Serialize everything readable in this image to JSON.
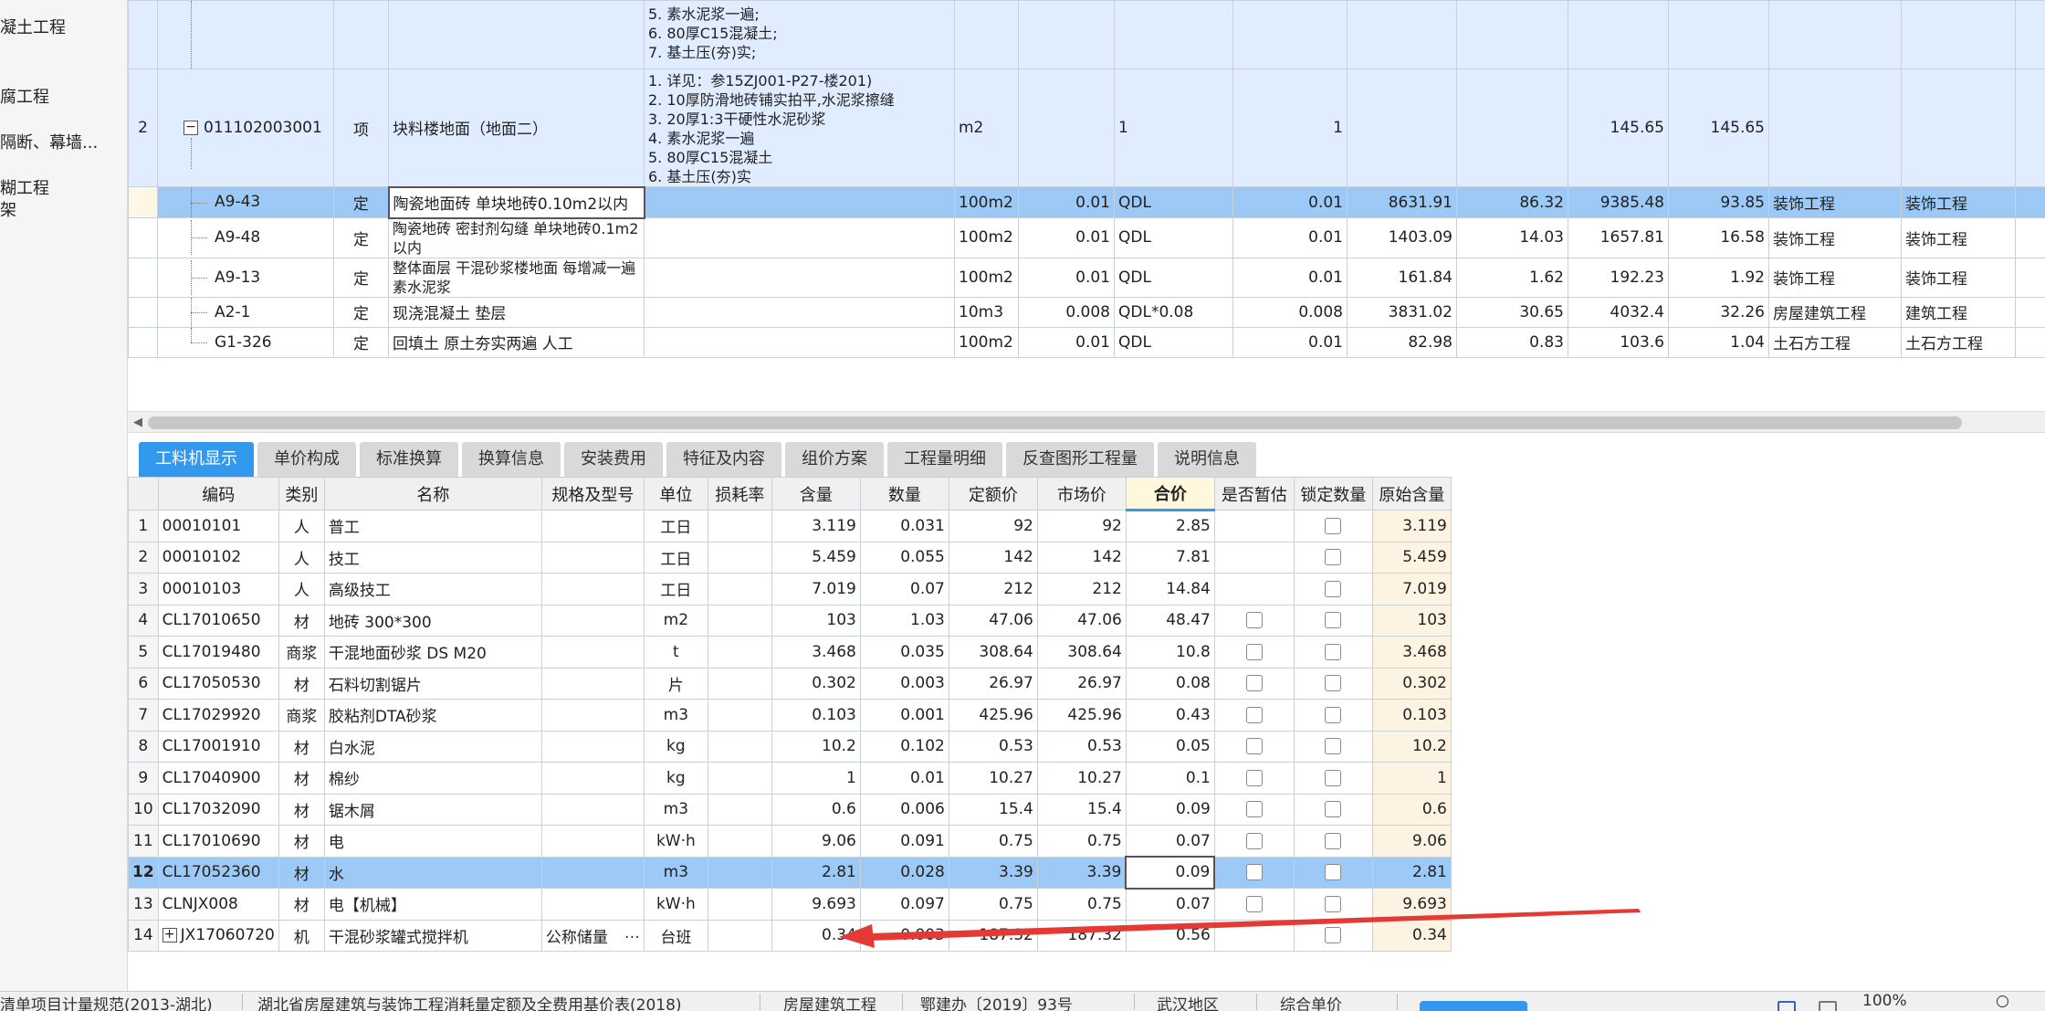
{
  "sidebar": {
    "items": [
      "凝土工程",
      "腐工程",
      "隔断、幕墙...",
      "糊工程",
      "架"
    ]
  },
  "upper_rows": [
    {
      "desc": [
        "5. 素水泥浆一遍;",
        "6. 80厚C15混凝土;",
        "7. 基土压(夯)实;"
      ]
    },
    {
      "num": "2",
      "code": "011102003001",
      "type": "项",
      "name": "块料楼地面（地面二）",
      "desc": [
        "1. 详见：参15ZJ001-P27-楼201)",
        "2. 10厚防滑地砖铺实拍平,水泥浆擦缝",
        "3. 20厚1:3干硬性水泥砂浆",
        "4. 素水泥浆一遍",
        "5. 80厚C15混凝土",
        "6. 基土压(夯)实"
      ],
      "unit": "m2",
      "qty_expr": "1",
      "qty": "1",
      "price_a": "",
      "price_b": "",
      "v1": "145.65",
      "v2": "145.65",
      "cat1": "",
      "cat2": ""
    },
    {
      "code": "A9-43",
      "type": "定",
      "name": "陶瓷地面砖 单块地砖0.10m2以内",
      "unit": "100m2",
      "ratio": "0.01",
      "qty_expr": "QDL",
      "qty": "0.01",
      "p1": "8631.91",
      "p2": "86.32",
      "p3": "9385.48",
      "p4": "93.85",
      "cat1": "装饰工程",
      "cat2": "装饰工程"
    },
    {
      "code": "A9-48",
      "type": "定",
      "name": "陶瓷地砖 密封剂勾缝 单块地砖0.1m2以内",
      "unit": "100m2",
      "ratio": "0.01",
      "qty_expr": "QDL",
      "qty": "0.01",
      "p1": "1403.09",
      "p2": "14.03",
      "p3": "1657.81",
      "p4": "16.58",
      "cat1": "装饰工程",
      "cat2": "装饰工程"
    },
    {
      "code": "A9-13",
      "type": "定",
      "name": "整体面层 干混砂浆楼地面 每增减一遍素水泥浆",
      "unit": "100m2",
      "ratio": "0.01",
      "qty_expr": "QDL",
      "qty": "0.01",
      "p1": "161.84",
      "p2": "1.62",
      "p3": "192.23",
      "p4": "1.92",
      "cat1": "装饰工程",
      "cat2": "装饰工程"
    },
    {
      "code": "A2-1",
      "type": "定",
      "name": "现浇混凝土 垫层",
      "unit": "10m3",
      "ratio": "0.008",
      "qty_expr": "QDL*0.08",
      "qty": "0.008",
      "p1": "3831.02",
      "p2": "30.65",
      "p3": "4032.4",
      "p4": "32.26",
      "cat1": "房屋建筑工程",
      "cat2": "建筑工程"
    },
    {
      "code": "G1-326",
      "type": "定",
      "name": "回填土 原土夯实两遍 人工",
      "unit": "100m2",
      "ratio": "0.01",
      "qty_expr": "QDL",
      "qty": "0.01",
      "p1": "82.98",
      "p2": "0.83",
      "p3": "103.6",
      "p4": "1.04",
      "cat1": "土石方工程",
      "cat2": "土石方工程"
    }
  ],
  "tabs": [
    "工料机显示",
    "单价构成",
    "标准换算",
    "换算信息",
    "安装费用",
    "特征及内容",
    "组价方案",
    "工程量明细",
    "反查图形工程量",
    "说明信息"
  ],
  "lower_headers": [
    "编码",
    "类别",
    "名称",
    "规格及型号",
    "单位",
    "损耗率",
    "含量",
    "数量",
    "定额价",
    "市场价",
    "合价",
    "是否暂估",
    "锁定数量",
    "原始含量"
  ],
  "lower_rows": [
    {
      "n": "1",
      "code": "00010101",
      "cat": "人",
      "name": "普工",
      "spec": "",
      "unit": "工日",
      "loss": "",
      "content": "3.119",
      "qty": "0.031",
      "quota": "92",
      "market": "92",
      "total": "2.85",
      "est": false,
      "orig": "3.119"
    },
    {
      "n": "2",
      "code": "00010102",
      "cat": "人",
      "name": "技工",
      "spec": "",
      "unit": "工日",
      "loss": "",
      "content": "5.459",
      "qty": "0.055",
      "quota": "142",
      "market": "142",
      "total": "7.81",
      "est": false,
      "orig": "5.459"
    },
    {
      "n": "3",
      "code": "00010103",
      "cat": "人",
      "name": "高级技工",
      "spec": "",
      "unit": "工日",
      "loss": "",
      "content": "7.019",
      "qty": "0.07",
      "quota": "212",
      "market": "212",
      "total": "14.84",
      "est": false,
      "orig": "7.019"
    },
    {
      "n": "4",
      "code": "CL17010650",
      "cat": "材",
      "name": "地砖 300*300",
      "spec": "",
      "unit": "m2",
      "loss": "",
      "content": "103",
      "qty": "1.03",
      "quota": "47.06",
      "market": "47.06",
      "total": "48.47",
      "est": true,
      "orig": "103"
    },
    {
      "n": "5",
      "code": "CL17019480",
      "cat": "商浆",
      "name": "干混地面砂浆 DS M20",
      "spec": "",
      "unit": "t",
      "loss": "",
      "content": "3.468",
      "qty": "0.035",
      "quota": "308.64",
      "market": "308.64",
      "total": "10.8",
      "est": true,
      "orig": "3.468"
    },
    {
      "n": "6",
      "code": "CL17050530",
      "cat": "材",
      "name": "石料切割锯片",
      "spec": "",
      "unit": "片",
      "loss": "",
      "content": "0.302",
      "qty": "0.003",
      "quota": "26.97",
      "market": "26.97",
      "total": "0.08",
      "est": true,
      "orig": "0.302"
    },
    {
      "n": "7",
      "code": "CL17029920",
      "cat": "商浆",
      "name": "胶粘剂DTA砂浆",
      "spec": "",
      "unit": "m3",
      "loss": "",
      "content": "0.103",
      "qty": "0.001",
      "quota": "425.96",
      "market": "425.96",
      "total": "0.43",
      "est": true,
      "orig": "0.103"
    },
    {
      "n": "8",
      "code": "CL17001910",
      "cat": "材",
      "name": "白水泥",
      "spec": "",
      "unit": "kg",
      "loss": "",
      "content": "10.2",
      "qty": "0.102",
      "quota": "0.53",
      "market": "0.53",
      "total": "0.05",
      "est": true,
      "orig": "10.2"
    },
    {
      "n": "9",
      "code": "CL17040900",
      "cat": "材",
      "name": "棉纱",
      "spec": "",
      "unit": "kg",
      "loss": "",
      "content": "1",
      "qty": "0.01",
      "quota": "10.27",
      "market": "10.27",
      "total": "0.1",
      "est": true,
      "orig": "1"
    },
    {
      "n": "10",
      "code": "CL17032090",
      "cat": "材",
      "name": "锯木屑",
      "spec": "",
      "unit": "m3",
      "loss": "",
      "content": "0.6",
      "qty": "0.006",
      "quota": "15.4",
      "market": "15.4",
      "total": "0.09",
      "est": true,
      "orig": "0.6"
    },
    {
      "n": "11",
      "code": "CL17010690",
      "cat": "材",
      "name": "电",
      "spec": "",
      "unit": "kW·h",
      "loss": "",
      "content": "9.06",
      "qty": "0.091",
      "quota": "0.75",
      "market": "0.75",
      "total": "0.07",
      "est": true,
      "orig": "9.06"
    },
    {
      "n": "12",
      "code": "CL17052360",
      "cat": "材",
      "name": "水",
      "spec": "",
      "unit": "m3",
      "loss": "",
      "content": "2.81",
      "qty": "0.028",
      "quota": "3.39",
      "market": "3.39",
      "total": "0.09",
      "est": true,
      "orig": "2.81"
    },
    {
      "n": "13",
      "code": "CLNJX008",
      "cat": "材",
      "name": "电【机械】",
      "spec": "",
      "unit": "kW·h",
      "loss": "",
      "content": "9.693",
      "qty": "0.097",
      "quota": "0.75",
      "market": "0.75",
      "total": "0.07",
      "est": true,
      "orig": "9.693"
    },
    {
      "n": "14",
      "code": "JX17060720",
      "cat": "机",
      "name": "干混砂浆罐式搅拌机",
      "spec": "公称储量",
      "unit": "台班",
      "loss": "",
      "content": "0.34",
      "qty": "0.003",
      "quota": "187.32",
      "market": "187.32",
      "total": "0.56",
      "est": false,
      "orig": "0.34"
    }
  ],
  "ellipsis": "…",
  "statusbar": {
    "items": [
      "清单项目计量规范(2013-湖北)",
      "湖北省房屋建筑与装饰工程消耗量定额及全费用基价表(2018)",
      "房屋建筑工程",
      "鄂建办〔2019〕93号",
      "武汉地区",
      "综合单价",
      "100%"
    ]
  },
  "colors": {
    "accent": "#3399ee",
    "selected_row": "#9cc9f5",
    "annotation_arrow": "#e53935"
  }
}
